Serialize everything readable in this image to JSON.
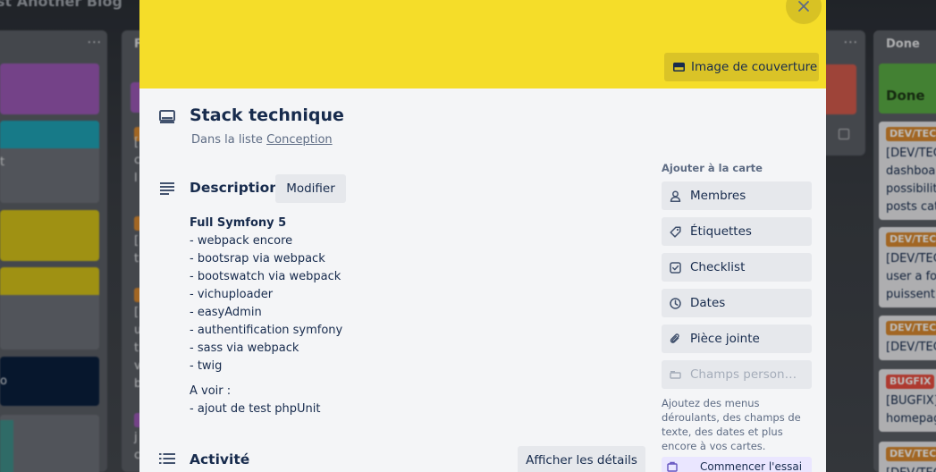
{
  "board": {
    "title": "st Another Blog",
    "menu_glyph": "···",
    "right_col_head": "Done",
    "left_fragments": [
      "t",
      "o"
    ],
    "mid_fragments": [
      "F",
      "[",
      "c",
      "l",
      "[",
      "t",
      "[",
      "u",
      "t",
      "v",
      "b",
      "j",
      "c"
    ],
    "right_cards": [
      {
        "tag": "DEV/TEC",
        "lines": [
          "[DEV/TEC",
          "dashboa",
          "possibilit",
          "posts cat"
        ]
      },
      {
        "tag": "DEV/TEC",
        "lines": [
          "[DEV/TEC",
          "user a fo",
          "puissent"
        ]
      },
      {
        "tag": "DEV/TEC",
        "lines": [
          "[DEV/TEC"
        ]
      },
      {
        "tag": "BUGFIX",
        "lines": [
          "[BUGFIX]",
          "homepag"
        ]
      },
      {
        "tag": "DEV/TEC",
        "lines": [
          "[DEV/TEC"
        ]
      }
    ],
    "done_card_label": "Done",
    "colors": {
      "purple": "#9b59b6",
      "teal": "#1fa3b6",
      "yellow": "#d4c21a",
      "navy": "#0a1f3d",
      "red": "#d35b4d",
      "green": "#5aac44",
      "orange": "#d8892f",
      "bugfix": "#e84e40"
    }
  },
  "modal": {
    "cover_color": "#f5dd29",
    "close_icon": "close-icon",
    "cover_button": "Image de couverture",
    "title": "Stack technique",
    "in_list_prefix": "Dans la liste",
    "in_list_link": "Conception",
    "description": {
      "heading": "Description",
      "edit_button": "Modifier",
      "title_line": "Full Symfony 5",
      "lines": [
        "- webpack encore",
        "- bootsrap via webpack",
        "- bootswatch via webpack",
        "- vichuploader",
        "- easyAdmin",
        "- authentification symfony",
        "- sass via webpack",
        "- twig"
      ],
      "todo_title": "A voir :",
      "todo_lines": [
        "- ajout de test phpUnit"
      ]
    },
    "activity": {
      "heading": "Activité",
      "details_button": "Afficher les détails"
    },
    "sidebar": {
      "title": "Ajouter à la carte",
      "items": [
        {
          "label": "Membres",
          "icon": "user-icon"
        },
        {
          "label": "Étiquettes",
          "icon": "tag-icon"
        },
        {
          "label": "Checklist",
          "icon": "checklist-icon"
        },
        {
          "label": "Dates",
          "icon": "clock-icon"
        },
        {
          "label": "Pièce jointe",
          "icon": "paperclip-icon"
        },
        {
          "label": "Champs personnalisés",
          "icon": "custom-fields-icon"
        }
      ],
      "note": "Ajoutez des menus déroulants, des champs de texte, des dates et plus encore à vos cartes.",
      "trial_button": "Commencer l'essai"
    }
  }
}
